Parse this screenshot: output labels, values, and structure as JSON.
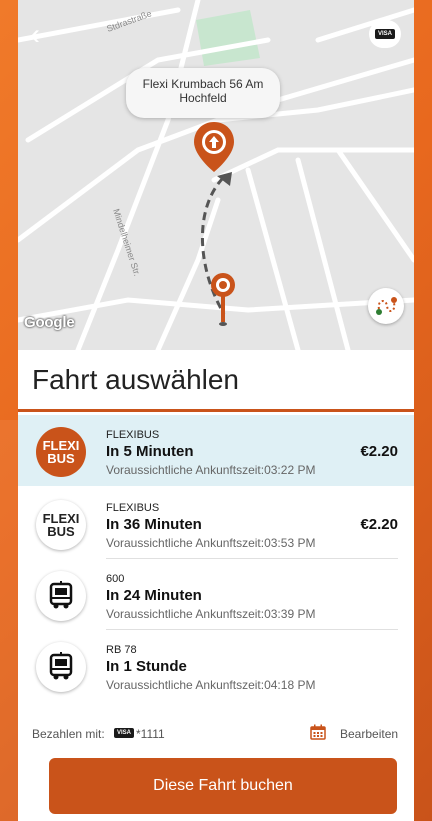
{
  "colors": {
    "accent": "#c9531a",
    "selected_row": "#dff0f5",
    "background_brand": "#e8681e"
  },
  "map": {
    "streets": [
      "Stdrastraße",
      "Mindelheimer Str."
    ],
    "destination_label": "Flexi Krumbach 56 Am Hochfeld",
    "google_label": "Google",
    "icons": [
      "back-chevron-icon",
      "visa-card-icon",
      "destination-pin-icon",
      "origin-pin-icon",
      "route-toggle-icon"
    ]
  },
  "title": "Fahrt auswählen",
  "trips": [
    {
      "provider": "FLEXIBUS",
      "time": "In 5 Minuten",
      "arrival": "Voraussichtliche Ankunftszeit:03:22 PM",
      "price": "€2.20",
      "icon": "flexibus-logo",
      "logo_line1": "FLEXI",
      "logo_line2": "BUS",
      "selected": true
    },
    {
      "provider": "FLEXIBUS",
      "time": "In 36 Minuten",
      "arrival": "Voraussichtliche Ankunftszeit:03:53 PM",
      "price": "€2.20",
      "icon": "flexibus-logo",
      "logo_line1": "FLEXI",
      "logo_line2": "BUS",
      "selected": false
    },
    {
      "provider": "600",
      "time": "In 24 Minuten",
      "arrival": "Voraussichtliche Ankunftszeit:03:39 PM",
      "price": "",
      "icon": "bus-icon",
      "selected": false
    },
    {
      "provider": "RB 78",
      "time": "In 1 Stunde",
      "arrival": "Voraussichtliche Ankunftszeit:04:18 PM",
      "price": "",
      "icon": "bus-icon",
      "selected": false
    }
  ],
  "payment": {
    "label": "Bezahlen mit:",
    "card_brand": "VISA",
    "card_number": "*1111",
    "edit_label": "Bearbeiten"
  },
  "book_button": "Diese Fahrt buchen"
}
